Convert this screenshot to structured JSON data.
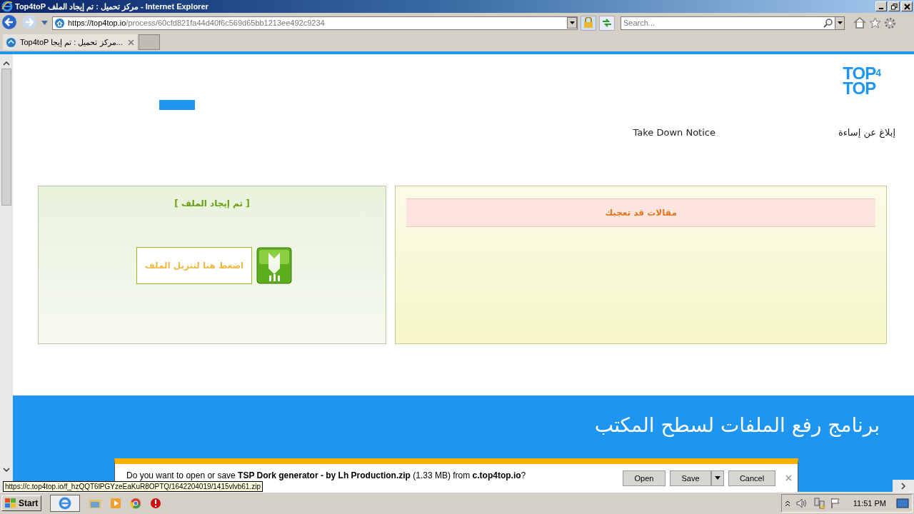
{
  "window": {
    "title": "Top4toP مركز تحميل : تم إيجاد الملف - Internet Explorer"
  },
  "address": {
    "host": "https://top4top.io",
    "path": "/process/60cfd821fa44d40f6c569d65bb1213ee492c9234"
  },
  "search": {
    "placeholder": "Search..."
  },
  "tabs": [
    {
      "label": "Top4toP مركز تحميل : تم إيجا...",
      "selected": true
    }
  ],
  "page": {
    "logo": [
      "TOP",
      "4",
      "TOP"
    ],
    "nav": [
      "إبلاغ عن إساءة",
      "Take Down Notice"
    ],
    "file_panel": {
      "title": "[ تم إيجاد الملف ]",
      "download_link": "اضغط هنا لتنزيل الملف"
    },
    "articles_panel": {
      "title": "مقالات قد تعجبك"
    },
    "footer": {
      "heading": "برنامج رفع الملفات لسطح المكتب"
    }
  },
  "download_bar": {
    "message": "Do you want to open or save **TSP Dork generator - by Lh Production.zip** (1.33 MB) from **c.top4top.io**?",
    "open_button": "Open",
    "save_button": "Save",
    "cancel_button": "Cancel"
  },
  "status_url": "https://c.top4top.io/f_hzQQT6lPGYzeEaKuR8OPTQ/1642204019/1415vlvb61.zip",
  "taskbar": {
    "start": "Start",
    "clock": "11:51 PM"
  }
}
